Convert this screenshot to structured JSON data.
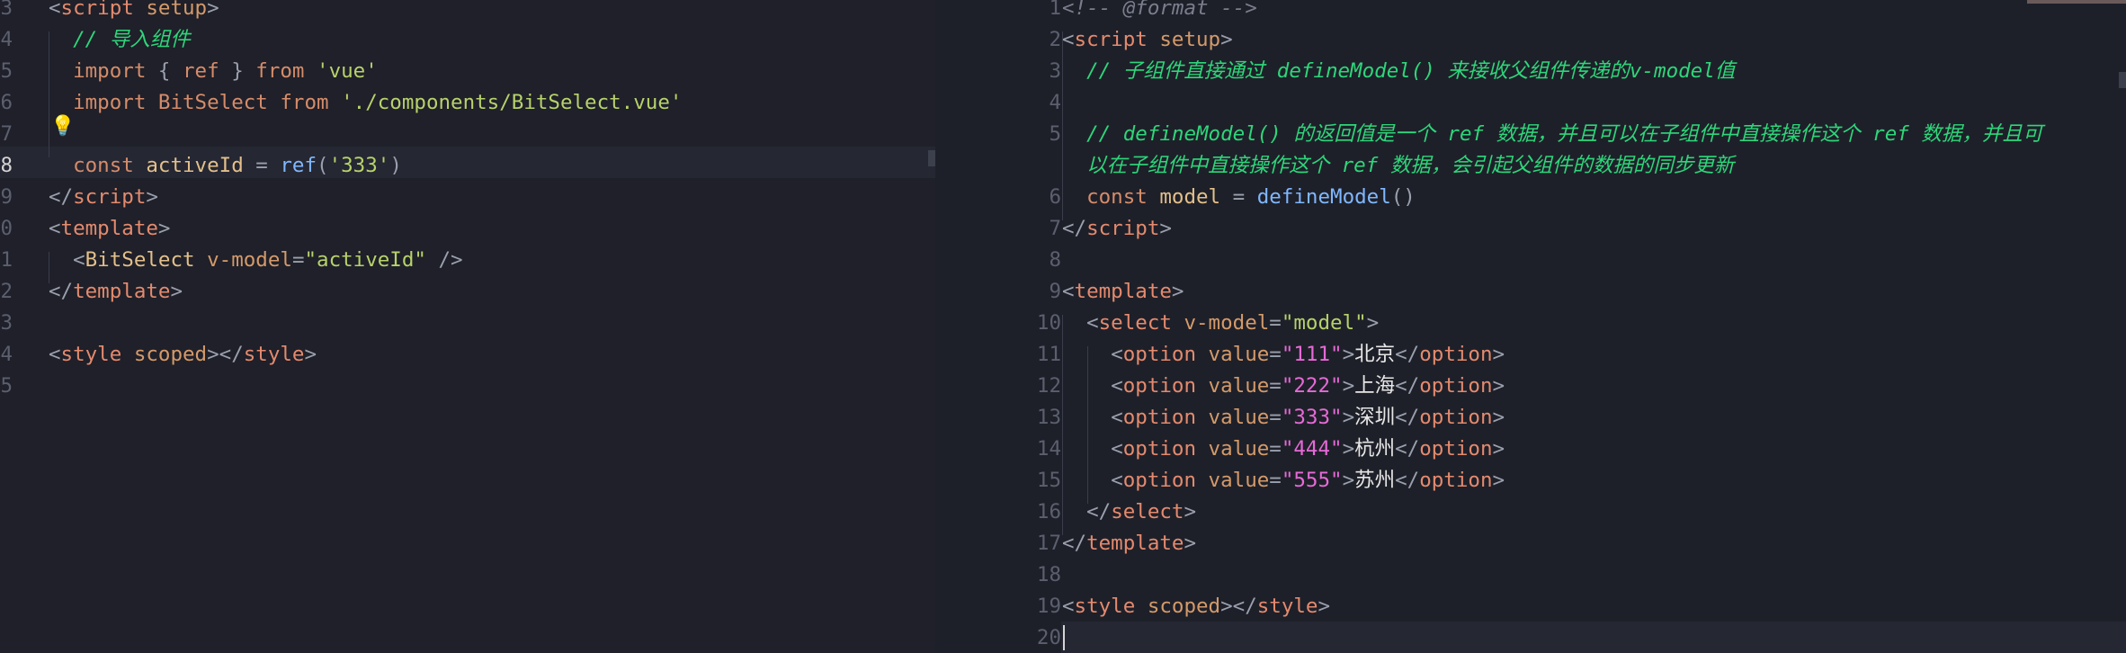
{
  "left_editor": {
    "lines": [
      {
        "num": "3",
        "tokens": [
          {
            "t": "<",
            "c": "c-punct"
          },
          {
            "t": "script",
            "c": "c-tag"
          },
          {
            "t": " setup",
            "c": "c-attr"
          },
          {
            "t": ">",
            "c": "c-punct"
          }
        ]
      },
      {
        "num": "4",
        "tokens": [
          {
            "t": "  "
          },
          {
            "t": "// 导入组件",
            "c": "c-comment"
          }
        ]
      },
      {
        "num": "5",
        "tokens": [
          {
            "t": "  "
          },
          {
            "t": "import",
            "c": "c-kw"
          },
          {
            "t": " { ",
            "c": "c-punct"
          },
          {
            "t": "ref",
            "c": "c-kw"
          },
          {
            "t": " } ",
            "c": "c-punct"
          },
          {
            "t": "from",
            "c": "c-kw"
          },
          {
            "t": " 'vue'",
            "c": "c-str"
          }
        ]
      },
      {
        "num": "6",
        "tokens": [
          {
            "t": "  "
          },
          {
            "t": "import",
            "c": "c-kw"
          },
          {
            "t": " BitSelect ",
            "c": "c-kw"
          },
          {
            "t": "from",
            "c": "c-kw"
          },
          {
            "t": " './components/BitSelect.vue'",
            "c": "c-str"
          }
        ]
      },
      {
        "num": "7",
        "tokens": []
      },
      {
        "num": "8",
        "tokens": [
          {
            "t": "  "
          },
          {
            "t": "const",
            "c": "c-kw"
          },
          {
            "t": " activeId ",
            "c": "c-ident"
          },
          {
            "t": "= ",
            "c": "c-punct"
          },
          {
            "t": "ref",
            "c": "c-fn"
          },
          {
            "t": "(",
            "c": "c-punct"
          },
          {
            "t": "'333'",
            "c": "c-str"
          },
          {
            "t": ")",
            "c": "c-punct"
          }
        ]
      },
      {
        "num": "9",
        "tokens": [
          {
            "t": "</",
            "c": "c-punct"
          },
          {
            "t": "script",
            "c": "c-tag"
          },
          {
            "t": ">",
            "c": "c-punct"
          }
        ]
      },
      {
        "num": "0",
        "tokens": [
          {
            "t": "<",
            "c": "c-punct"
          },
          {
            "t": "template",
            "c": "c-tag"
          },
          {
            "t": ">",
            "c": "c-punct"
          }
        ]
      },
      {
        "num": "1",
        "tokens": [
          {
            "t": "  "
          },
          {
            "t": "<",
            "c": "c-punct"
          },
          {
            "t": "BitSelect",
            "c": "c-ident"
          },
          {
            "t": " v-model",
            "c": "c-attr"
          },
          {
            "t": "=",
            "c": "c-punct"
          },
          {
            "t": "\"activeId\"",
            "c": "c-str"
          },
          {
            "t": " />",
            "c": "c-punct"
          }
        ]
      },
      {
        "num": "2",
        "tokens": [
          {
            "t": "</",
            "c": "c-punct"
          },
          {
            "t": "template",
            "c": "c-tag"
          },
          {
            "t": ">",
            "c": "c-punct"
          }
        ]
      },
      {
        "num": "3",
        "tokens": []
      },
      {
        "num": "4",
        "tokens": [
          {
            "t": "<",
            "c": "c-punct"
          },
          {
            "t": "style",
            "c": "c-tag"
          },
          {
            "t": " scoped",
            "c": "c-attr"
          },
          {
            "t": "></",
            "c": "c-punct"
          },
          {
            "t": "style",
            "c": "c-tag"
          },
          {
            "t": ">",
            "c": "c-punct"
          }
        ]
      },
      {
        "num": "5",
        "tokens": []
      }
    ]
  },
  "right_editor": {
    "lines": [
      {
        "num": "1",
        "tokens": [
          {
            "t": "<!-- @format -->",
            "c": "c-comment-grey"
          }
        ]
      },
      {
        "num": "2",
        "tokens": [
          {
            "t": "<",
            "c": "c-punct"
          },
          {
            "t": "script",
            "c": "c-tag"
          },
          {
            "t": " setup",
            "c": "c-attr"
          },
          {
            "t": ">",
            "c": "c-punct"
          }
        ]
      },
      {
        "num": "3",
        "tokens": [
          {
            "t": "  "
          },
          {
            "t": "// 子组件直接通过 defineModel() 来接收父组件传递的v-model值",
            "c": "c-comment"
          }
        ]
      },
      {
        "num": "4",
        "tokens": []
      },
      {
        "num": "5",
        "tokens": [
          {
            "t": "  "
          },
          {
            "t": "// defineModel() 的返回值是一个 ref 数据，并且可以在子组件中直接操作这个 ref 数据，并且可",
            "c": "c-comment"
          }
        ]
      },
      {
        "num": "",
        "tokens": [
          {
            "t": "  "
          },
          {
            "t": "以在子组件中直接操作这个 ref 数据，会引起父组件的数据的同步更新",
            "c": "c-comment"
          }
        ]
      },
      {
        "num": "6",
        "tokens": [
          {
            "t": "  "
          },
          {
            "t": "const",
            "c": "c-kw"
          },
          {
            "t": " model ",
            "c": "c-ident"
          },
          {
            "t": "= ",
            "c": "c-punct"
          },
          {
            "t": "defineModel",
            "c": "c-fn"
          },
          {
            "t": "()",
            "c": "c-punct"
          }
        ]
      },
      {
        "num": "7",
        "tokens": [
          {
            "t": "</",
            "c": "c-punct"
          },
          {
            "t": "script",
            "c": "c-tag"
          },
          {
            "t": ">",
            "c": "c-punct"
          }
        ]
      },
      {
        "num": "8",
        "tokens": []
      },
      {
        "num": "9",
        "tokens": [
          {
            "t": "<",
            "c": "c-punct"
          },
          {
            "t": "template",
            "c": "c-tag"
          },
          {
            "t": ">",
            "c": "c-punct"
          }
        ]
      },
      {
        "num": "10",
        "tokens": [
          {
            "t": "  "
          },
          {
            "t": "<",
            "c": "c-punct"
          },
          {
            "t": "select",
            "c": "c-tag"
          },
          {
            "t": " v-model",
            "c": "c-attr"
          },
          {
            "t": "=",
            "c": "c-punct"
          },
          {
            "t": "\"model\"",
            "c": "c-str"
          },
          {
            "t": ">",
            "c": "c-punct"
          }
        ]
      },
      {
        "num": "11",
        "tokens": [
          {
            "t": "    "
          },
          {
            "t": "<",
            "c": "c-punct"
          },
          {
            "t": "option",
            "c": "c-tag"
          },
          {
            "t": " value",
            "c": "c-attr"
          },
          {
            "t": "=",
            "c": "c-punct"
          },
          {
            "t": "\"111\"",
            "c": "c-str2"
          },
          {
            "t": ">",
            "c": "c-punct"
          },
          {
            "t": "北京",
            "c": "c-white"
          },
          {
            "t": "</",
            "c": "c-punct"
          },
          {
            "t": "option",
            "c": "c-tag"
          },
          {
            "t": ">",
            "c": "c-punct"
          }
        ]
      },
      {
        "num": "12",
        "tokens": [
          {
            "t": "    "
          },
          {
            "t": "<",
            "c": "c-punct"
          },
          {
            "t": "option",
            "c": "c-tag"
          },
          {
            "t": " value",
            "c": "c-attr"
          },
          {
            "t": "=",
            "c": "c-punct"
          },
          {
            "t": "\"222\"",
            "c": "c-str2"
          },
          {
            "t": ">",
            "c": "c-punct"
          },
          {
            "t": "上海",
            "c": "c-white"
          },
          {
            "t": "</",
            "c": "c-punct"
          },
          {
            "t": "option",
            "c": "c-tag"
          },
          {
            "t": ">",
            "c": "c-punct"
          }
        ]
      },
      {
        "num": "13",
        "tokens": [
          {
            "t": "    "
          },
          {
            "t": "<",
            "c": "c-punct"
          },
          {
            "t": "option",
            "c": "c-tag"
          },
          {
            "t": " value",
            "c": "c-attr"
          },
          {
            "t": "=",
            "c": "c-punct"
          },
          {
            "t": "\"333\"",
            "c": "c-str2"
          },
          {
            "t": ">",
            "c": "c-punct"
          },
          {
            "t": "深圳",
            "c": "c-white"
          },
          {
            "t": "</",
            "c": "c-punct"
          },
          {
            "t": "option",
            "c": "c-tag"
          },
          {
            "t": ">",
            "c": "c-punct"
          }
        ]
      },
      {
        "num": "14",
        "tokens": [
          {
            "t": "    "
          },
          {
            "t": "<",
            "c": "c-punct"
          },
          {
            "t": "option",
            "c": "c-tag"
          },
          {
            "t": " value",
            "c": "c-attr"
          },
          {
            "t": "=",
            "c": "c-punct"
          },
          {
            "t": "\"444\"",
            "c": "c-str2"
          },
          {
            "t": ">",
            "c": "c-punct"
          },
          {
            "t": "杭州",
            "c": "c-white"
          },
          {
            "t": "</",
            "c": "c-punct"
          },
          {
            "t": "option",
            "c": "c-tag"
          },
          {
            "t": ">",
            "c": "c-punct"
          }
        ]
      },
      {
        "num": "15",
        "tokens": [
          {
            "t": "    "
          },
          {
            "t": "<",
            "c": "c-punct"
          },
          {
            "t": "option",
            "c": "c-tag"
          },
          {
            "t": " value",
            "c": "c-attr"
          },
          {
            "t": "=",
            "c": "c-punct"
          },
          {
            "t": "\"555\"",
            "c": "c-str2"
          },
          {
            "t": ">",
            "c": "c-punct"
          },
          {
            "t": "苏州",
            "c": "c-white"
          },
          {
            "t": "</",
            "c": "c-punct"
          },
          {
            "t": "option",
            "c": "c-tag"
          },
          {
            "t": ">",
            "c": "c-punct"
          }
        ]
      },
      {
        "num": "16",
        "tokens": [
          {
            "t": "  "
          },
          {
            "t": "</",
            "c": "c-punct"
          },
          {
            "t": "select",
            "c": "c-tag"
          },
          {
            "t": ">",
            "c": "c-punct"
          }
        ]
      },
      {
        "num": "17",
        "tokens": [
          {
            "t": "</",
            "c": "c-punct"
          },
          {
            "t": "template",
            "c": "c-tag"
          },
          {
            "t": ">",
            "c": "c-punct"
          }
        ]
      },
      {
        "num": "18",
        "tokens": []
      },
      {
        "num": "19",
        "tokens": [
          {
            "t": "<",
            "c": "c-punct"
          },
          {
            "t": "style",
            "c": "c-tag"
          },
          {
            "t": " scoped",
            "c": "c-attr"
          },
          {
            "t": "></",
            "c": "c-punct"
          },
          {
            "t": "style",
            "c": "c-tag"
          },
          {
            "t": ">",
            "c": "c-punct"
          }
        ]
      },
      {
        "num": "20",
        "tokens": []
      }
    ]
  },
  "icons": {
    "lightbulb": "lightbulb-icon"
  },
  "colors": {
    "background": "#1e2029",
    "comment": "#2ed67a",
    "keyword": "#d58c6a",
    "string": "#b7d26b",
    "string_value": "#e66ad7"
  }
}
